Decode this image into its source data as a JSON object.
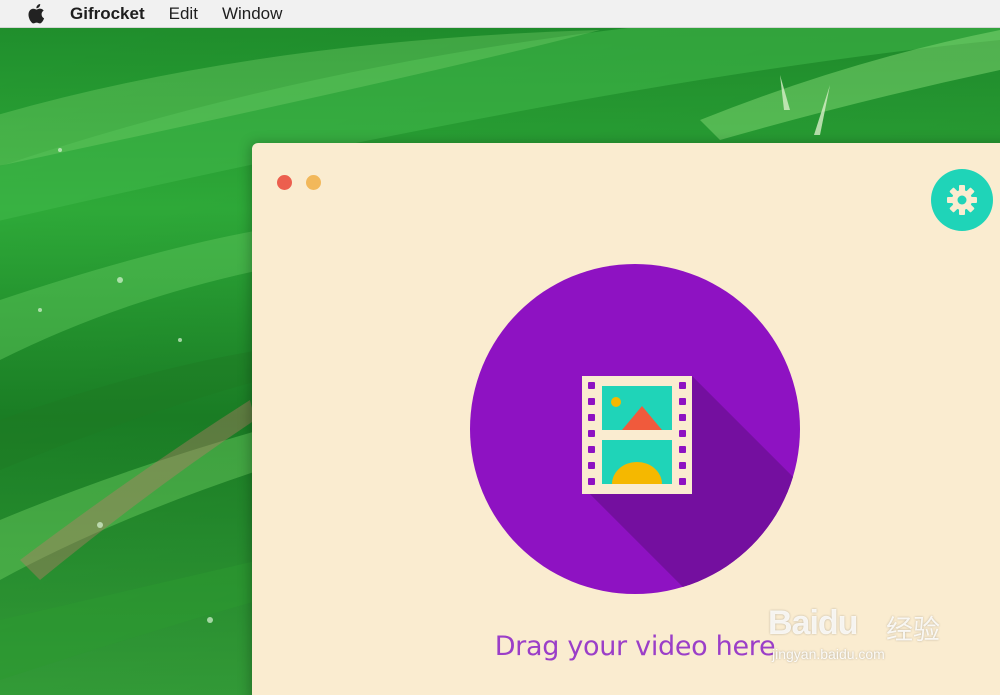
{
  "menubar": {
    "apple_icon": "apple-icon",
    "app_name": "Gifrocket",
    "items": [
      {
        "label": "Edit"
      },
      {
        "label": "Window"
      }
    ]
  },
  "window": {
    "title_buttons": [
      "close",
      "minimize"
    ],
    "settings_icon": "gear-icon",
    "drop_zone": {
      "icon": "film-image-icon",
      "label": "Drag your video here"
    }
  },
  "watermark": {
    "logo": "Baidu",
    "logo_cn": "经验",
    "url": "jingyan.baidu.com"
  },
  "colors": {
    "window_bg": "#faecd0",
    "accent_purple": "#8e12c2",
    "settings_teal": "#1fd4b8",
    "close_red": "#ec5f4e",
    "minimize_yellow": "#f2b85a",
    "label_purple": "#9b3ec8"
  }
}
